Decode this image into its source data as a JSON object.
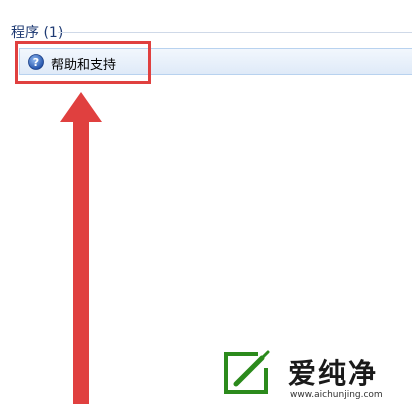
{
  "results": {
    "section_header": "程序 (1)",
    "items": [
      {
        "label": "帮助和支持",
        "icon": "help-icon"
      }
    ]
  },
  "annotation": {
    "highlight_color": "#e0403f",
    "arrow_color": "#e0403f"
  },
  "watermark": {
    "title": "爱纯净",
    "url": "www.aichunjing.com",
    "logo_color": "#2b8a1c"
  }
}
